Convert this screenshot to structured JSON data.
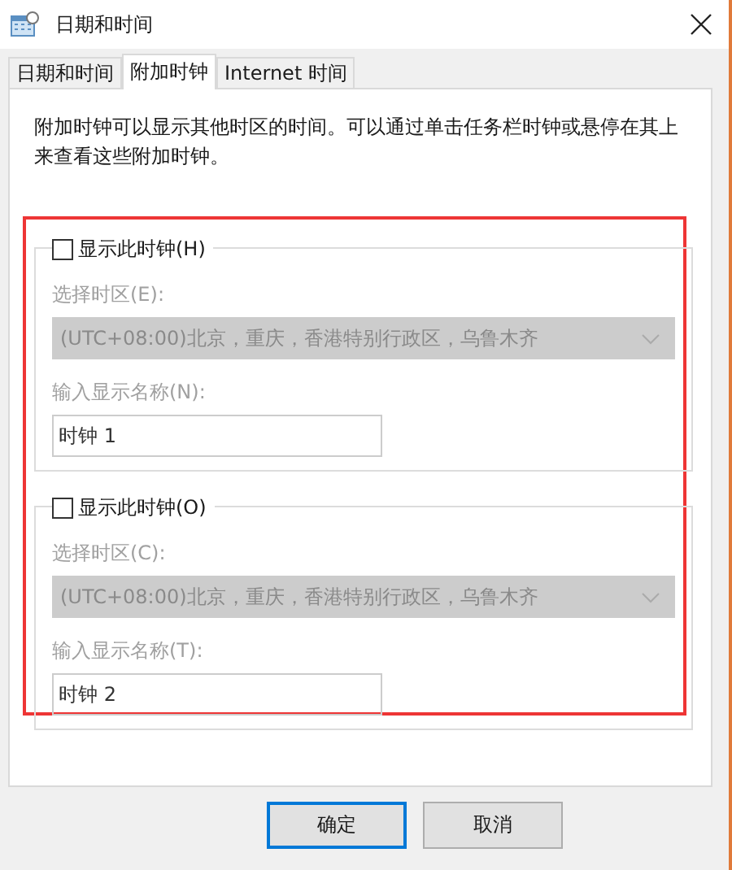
{
  "window": {
    "title": "日期和时间"
  },
  "tabs": [
    {
      "label": "日期和时间",
      "selected": false
    },
    {
      "label": "附加时钟",
      "selected": true
    },
    {
      "label": "Internet 时间",
      "selected": false
    }
  ],
  "description": "附加时钟可以显示其他时区的时间。可以通过单击任务栏时钟或悬停在其上来查看这些附加时钟。",
  "clocks": [
    {
      "show_label": "显示此时钟(H)",
      "checked": false,
      "timezone_label": "选择时区(E):",
      "timezone": "(UTC+08:00)北京，重庆，香港特别行政区，乌鲁木齐",
      "name_label": "输入显示名称(N):",
      "name": "时钟 1"
    },
    {
      "show_label": "显示此时钟(O)",
      "checked": false,
      "timezone_label": "选择时区(C):",
      "timezone": "(UTC+08:00)北京，重庆，香港特别行政区，乌鲁木齐",
      "name_label": "输入显示名称(T):",
      "name": "时钟 2"
    }
  ],
  "buttons": [
    {
      "label": "确定",
      "selected": true
    },
    {
      "label": "取消",
      "selected": false
    }
  ]
}
